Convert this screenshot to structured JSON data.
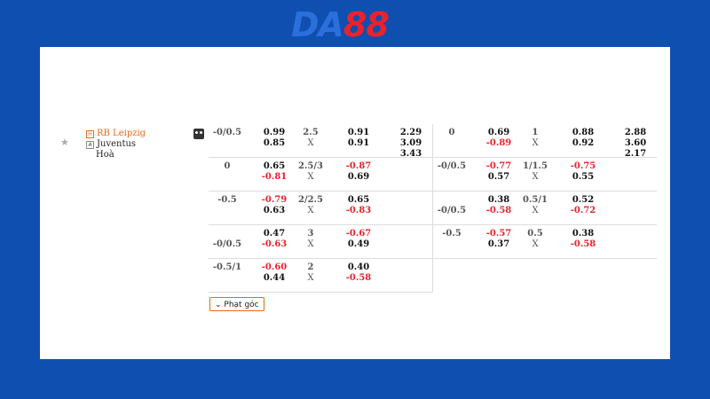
{
  "brand": {
    "da": "DA",
    "n88": "88"
  },
  "match": {
    "home": "RB Leipzig",
    "away": "Juventus",
    "draw": "Hoà",
    "home_badge": "H",
    "away_badge": "A"
  },
  "corner_button": "Phạt góc",
  "left_rows": [
    {
      "hcp": "-0/0.5",
      "hcp2": "",
      "h1": "0.99",
      "h2": "0.85",
      "ou": "2.5",
      "x": "X",
      "o1": "0.91",
      "o2": "0.91",
      "e1": "2.29",
      "e2": "3.09",
      "e3": "3.43"
    },
    {
      "hcp": "0",
      "hcp2": "",
      "h1": "0.65",
      "h2": "-0.81",
      "ou": "2.5/3",
      "x": "X",
      "o1": "-0.87",
      "o2": "0.69",
      "e1": "",
      "e2": "",
      "e3": ""
    },
    {
      "hcp": "-0.5",
      "hcp2": "",
      "h1": "-0.79",
      "h2": "0.63",
      "ou": "2/2.5",
      "x": "X",
      "o1": "0.65",
      "o2": "-0.83",
      "e1": "",
      "e2": "",
      "e3": ""
    },
    {
      "hcp": "",
      "hcp2": "-0/0.5",
      "h1": "0.47",
      "h2": "-0.63",
      "ou": "3",
      "x": "X",
      "o1": "-0.67",
      "o2": "0.49",
      "e1": "",
      "e2": "",
      "e3": ""
    },
    {
      "hcp": "-0.5/1",
      "hcp2": "",
      "h1": "-0.60",
      "h2": "0.44",
      "ou": "2",
      "x": "X",
      "o1": "0.40",
      "o2": "-0.58",
      "e1": "",
      "e2": "",
      "e3": ""
    }
  ],
  "right_rows": [
    {
      "hcp": "0",
      "hcp2": "",
      "h1": "0.69",
      "h2": "-0.89",
      "ou": "1",
      "x": "X",
      "o1": "0.88",
      "o2": "0.92",
      "e1": "2.88",
      "e2": "3.60",
      "e3": "2.17"
    },
    {
      "hcp": "-0/0.5",
      "hcp2": "",
      "h1": "-0.77",
      "h2": "0.57",
      "ou": "1/1.5",
      "x": "X",
      "o1": "-0.75",
      "o2": "0.55",
      "e1": "",
      "e2": "",
      "e3": ""
    },
    {
      "hcp": "",
      "hcp2": "-0/0.5",
      "h1": "0.38",
      "h2": "-0.58",
      "ou": "0.5/1",
      "x": "X",
      "o1": "0.52",
      "o2": "-0.72",
      "e1": "",
      "e2": "",
      "e3": ""
    },
    {
      "hcp": "-0.5",
      "hcp2": "",
      "h1": "-0.57",
      "h2": "0.37",
      "ou": "0.5",
      "x": "X",
      "o1": "0.38",
      "o2": "-0.58",
      "e1": "",
      "e2": "",
      "e3": ""
    }
  ]
}
